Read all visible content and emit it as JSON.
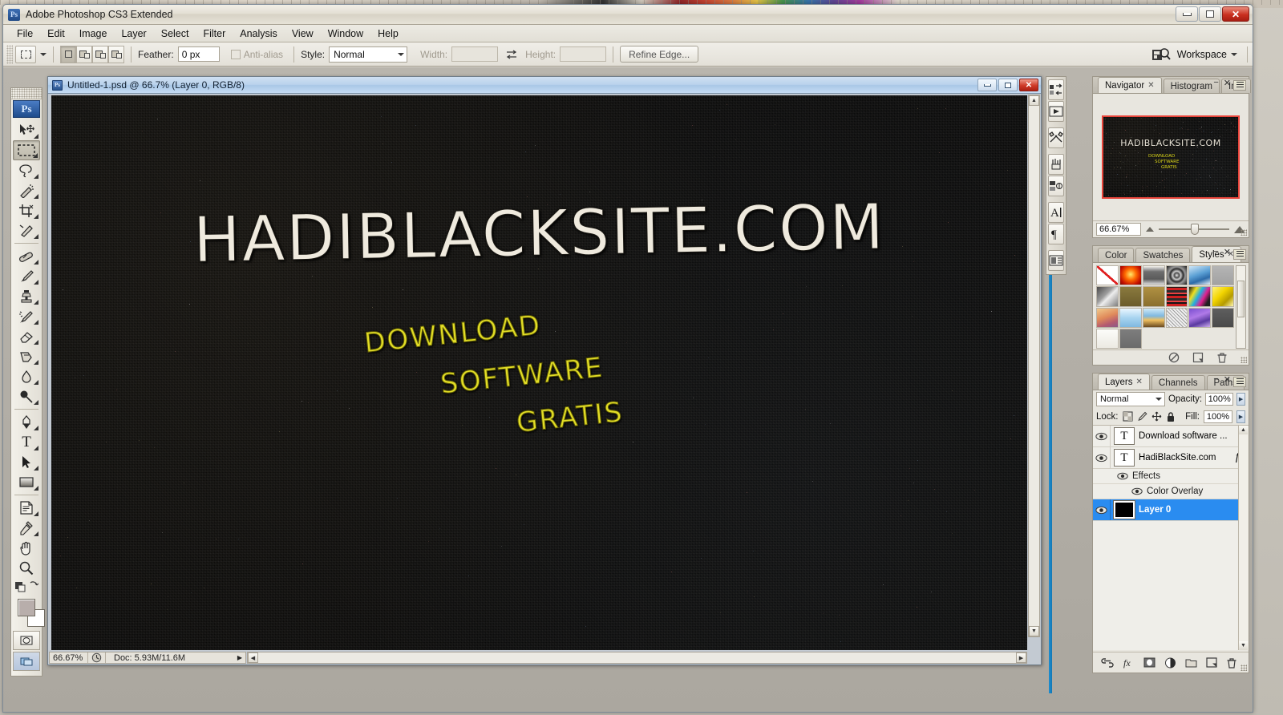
{
  "app": {
    "title": "Adobe Photoshop CS3 Extended",
    "logo": "Ps"
  },
  "window_controls": {
    "minimize": "minimize-icon",
    "maximize": "maximize-icon",
    "close": "✕"
  },
  "menubar": {
    "items": [
      "File",
      "Edit",
      "Image",
      "Layer",
      "Select",
      "Filter",
      "Analysis",
      "View",
      "Window",
      "Help"
    ]
  },
  "options_bar": {
    "tool": "rectangular-marquee",
    "feather_label": "Feather:",
    "feather_value": "0 px",
    "antialias_label": "Anti-alias",
    "antialias_checked": false,
    "style_label": "Style:",
    "style_value": "Normal",
    "width_label": "Width:",
    "width_value": "",
    "height_label": "Height:",
    "height_value": "",
    "refine_edge": "Refine Edge...",
    "workspace": "Workspace"
  },
  "toolbar": {
    "tools": [
      {
        "name": "move-tool",
        "selected": false
      },
      {
        "name": "rectangular-marquee-tool",
        "selected": true
      },
      {
        "name": "lasso-tool",
        "selected": false
      },
      {
        "name": "magic-wand-tool",
        "selected": false
      },
      {
        "name": "crop-tool",
        "selected": false
      },
      {
        "name": "slice-tool",
        "selected": false
      },
      {
        "name": "healing-brush-tool",
        "selected": false
      },
      {
        "name": "brush-tool",
        "selected": false
      },
      {
        "name": "clone-stamp-tool",
        "selected": false
      },
      {
        "name": "history-brush-tool",
        "selected": false
      },
      {
        "name": "eraser-tool",
        "selected": false
      },
      {
        "name": "gradient-tool",
        "selected": false
      },
      {
        "name": "blur-tool",
        "selected": false
      },
      {
        "name": "dodge-tool",
        "selected": false
      },
      {
        "name": "pen-tool",
        "selected": false
      },
      {
        "name": "horizontal-type-tool",
        "selected": false
      },
      {
        "name": "path-selection-tool",
        "selected": false
      },
      {
        "name": "rectangle-shape-tool",
        "selected": false
      },
      {
        "name": "notes-tool",
        "selected": false
      },
      {
        "name": "eyedropper-tool",
        "selected": false
      },
      {
        "name": "hand-tool",
        "selected": false
      },
      {
        "name": "zoom-tool",
        "selected": false
      }
    ],
    "foreground_color": "#b8aeab",
    "background_color": "#ffffff"
  },
  "document": {
    "title": "Untitled-1.psd @ 66.7% (Layer 0, RGB/8)",
    "canvas": {
      "background_color": "#0a0a0a",
      "main_text": "HADIBLACKSITE.COM",
      "main_text_color": "#efeade",
      "sub_lines": [
        "DOWNLOAD",
        "SOFTWARE",
        "GRATIS"
      ],
      "sub_text_color": "#e2dd26"
    },
    "status": {
      "zoom": "66.67%",
      "doc": "Doc: 5.93M/11.6M"
    }
  },
  "dock_icons": [
    "bridge-icon",
    "animation-icon",
    "tool-presets-icon",
    "brushes-icon",
    "clone-source-icon",
    "character-icon",
    "paragraph-icon",
    "layer-comps-icon"
  ],
  "navigator_panel": {
    "tabs": [
      {
        "label": "Navigator",
        "active": true,
        "closable": true
      },
      {
        "label": "Histogram",
        "active": false,
        "closable": false
      },
      {
        "label": "Info",
        "active": false,
        "closable": false
      }
    ],
    "zoom_value": "66.67%",
    "thumb_title": "HADIBLACKSITE.COM",
    "thumb_sub": [
      "DOWNLOAD",
      "SOFTWARE",
      "GRATIS"
    ],
    "view_box_color": "#e8443a"
  },
  "styles_panel": {
    "tabs": [
      {
        "label": "Color",
        "active": false,
        "closable": false
      },
      {
        "label": "Swatches",
        "active": false,
        "closable": false
      },
      {
        "label": "Styles",
        "active": true,
        "closable": true
      }
    ],
    "swatches": [
      {
        "name": "none-style",
        "fill": "none"
      },
      {
        "name": "red-glow-style",
        "fill": "radial-gradient(circle at 50% 45%, #ffe96a 0%, #ff6a00 38%, #c20f00 75%, #7a0a00 100%)"
      },
      {
        "name": "gray-button-style",
        "fill": "linear-gradient(180deg,#f3f1ec,#bdbdbd 12%, #6e6e6e 30%, #5a5a5a 70%, #dedede 100%)"
      },
      {
        "name": "dark-swirl-style",
        "fill": "radial-gradient(circle at 50% 50%, #efefef 0%, #4a4a4a 18%, #cfcfcf 30%, #2b2b2b 48%, #9a9a9a 62%, #1a1a1a 100%)"
      },
      {
        "name": "blue-sky-style",
        "fill": "linear-gradient(160deg,#cfe6f7 0%, #5a9fd4 45%, #2d6ba8 70%, #e8f2fb 100%)"
      },
      {
        "name": "flat-gray-style",
        "fill": "linear-gradient(180deg,#b4b4b4,#a2a2a2)"
      },
      {
        "name": "metal-corner-style",
        "fill": "linear-gradient(135deg,#4a4a4a 0%, #9c9c9c 40%, #ededed 55%, #7d7d7d 100%)"
      },
      {
        "name": "olive-style",
        "fill": "linear-gradient(180deg,#8a7a3e,#6b5c2b)"
      },
      {
        "name": "bronze-style",
        "fill": "linear-gradient(180deg,#b09142,#8a6f2e)"
      },
      {
        "name": "red-stripes-style",
        "fill": "repeating-linear-gradient(0deg,#d02020 0 3px,#151515 3px 5px,#e84040 5px 7px,#2a2a2a 7px 10px)"
      },
      {
        "name": "rainbow-noise-style",
        "fill": "linear-gradient(120deg,#1a1a1a 0%, #f0e020 25%, #20b0e0 45%, #e02090 65%, #202020 85%)"
      },
      {
        "name": "yellow-gel-style",
        "fill": "linear-gradient(135deg,#fff27a 0%, #f2d400 40%, #b59b00 70%, #fff7b0 100%)"
      },
      {
        "name": "sunset-style",
        "fill": "linear-gradient(160deg,#f0c98c 0%, #e08a5a 45%, #b35a70 75%, #8a5a8a 100%)"
      },
      {
        "name": "light-blue-style",
        "fill": "linear-gradient(180deg,#eaf6ff 0%, #a8d4f0 50%, #7fb8e0 100%)"
      },
      {
        "name": "horizon-style",
        "fill": "linear-gradient(180deg,#cfeaf8 0%, #7fb8e0 40%, #f0c060 62%, #6a4a20 100%)"
      },
      {
        "name": "scribble-texture-style",
        "fill": "repeating-linear-gradient(45deg,#efefef 0 2px,#9a9a9a 2px 3px), repeating-linear-gradient(-45deg,#ffffff 0 2px,#888 2px 3px)"
      },
      {
        "name": "purple-gradient-style",
        "fill": "linear-gradient(160deg,#7a4fd0 0%, #b07ae8 40%, #5a3aa0 70%, #d0b0f0 100%)"
      },
      {
        "name": "dark-slate-style",
        "fill": "linear-gradient(180deg,#5e5e5e,#4a4a4a)"
      },
      {
        "name": "white-style",
        "fill": "linear-gradient(180deg,#fcfcfa,#eceae3)"
      },
      {
        "name": "medium-gray-style",
        "fill": "linear-gradient(180deg,#7d7d7d,#6b6b6b)"
      }
    ],
    "footer_icons": [
      "clear-style-icon",
      "new-style-icon",
      "delete-style-icon"
    ]
  },
  "layers_panel": {
    "tabs": [
      {
        "label": "Layers",
        "active": true,
        "closable": true
      },
      {
        "label": "Channels",
        "active": false,
        "closable": false
      },
      {
        "label": "Paths",
        "active": false,
        "closable": false
      }
    ],
    "blend_mode": "Normal",
    "opacity_label": "Opacity:",
    "opacity_value": "100%",
    "lock_label": "Lock:",
    "lock_icons": [
      "lock-transparent-icon",
      "lock-image-icon",
      "lock-position-icon",
      "lock-all-icon"
    ],
    "fill_label": "Fill:",
    "fill_value": "100%",
    "layers": [
      {
        "kind": "text",
        "thumb": "T",
        "name": "Download    software ...",
        "visible": true,
        "selected": false,
        "has_fx": false
      },
      {
        "kind": "text",
        "thumb": "T",
        "name": "HadiBlackSite.com",
        "visible": true,
        "selected": false,
        "has_fx": true
      },
      {
        "kind": "effects",
        "name": "Effects",
        "visible": true,
        "selected": false
      },
      {
        "kind": "effect-item",
        "name": "Color Overlay",
        "visible": true,
        "selected": false
      },
      {
        "kind": "image",
        "thumb": "",
        "name": "Layer 0",
        "visible": true,
        "selected": true,
        "has_fx": false
      }
    ],
    "footer_icons": [
      "link-layers-icon",
      "add-layer-style-icon",
      "add-layer-mask-icon",
      "new-adjustment-layer-icon",
      "new-group-icon",
      "new-layer-icon",
      "delete-layer-icon"
    ],
    "selection_color": "#2a8cf0"
  }
}
